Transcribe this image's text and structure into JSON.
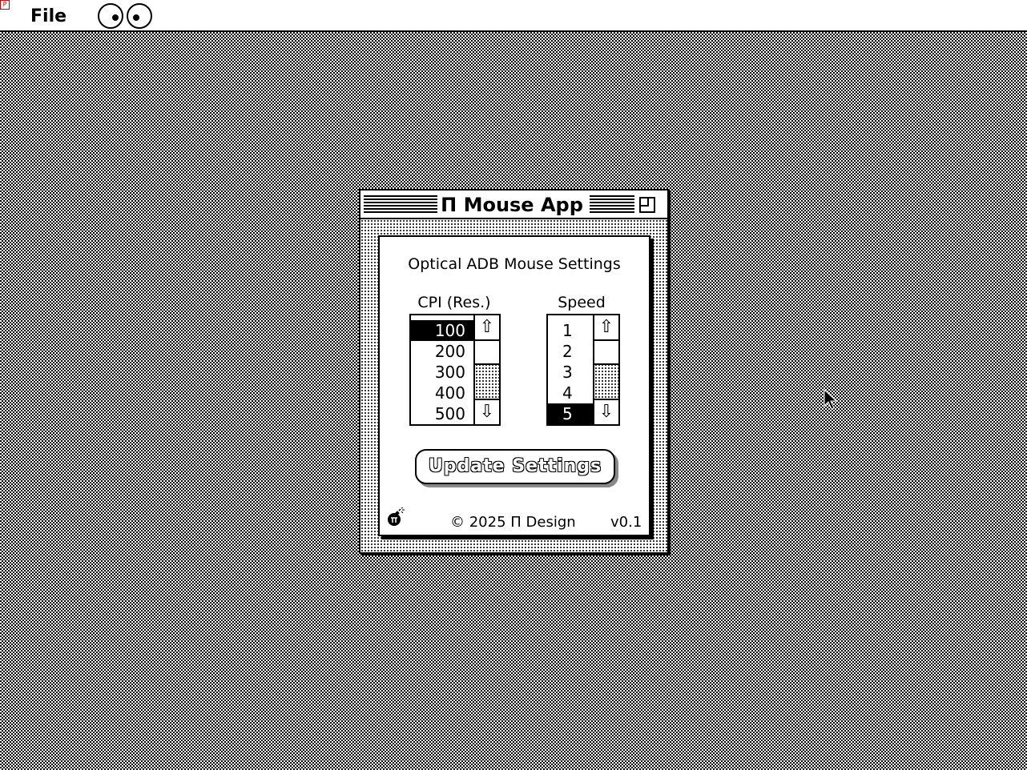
{
  "menubar": {
    "apple_glyph": "P",
    "file_label": "File",
    "eyes_icon": "xeyes-icon"
  },
  "window": {
    "title": "Π Mouse App"
  },
  "panel": {
    "heading": "Optical ADB Mouse Settings",
    "cpi": {
      "label": "CPI (Res.)",
      "items": [
        "100",
        "200",
        "300",
        "400",
        "500"
      ],
      "selected": "100"
    },
    "speed": {
      "label": "Speed",
      "items": [
        "1",
        "2",
        "3",
        "4",
        "5"
      ],
      "selected": "5"
    },
    "update_button": "Update Settings",
    "update_button_state": "disabled",
    "copyright": "© 2025 Π Design",
    "version": "v0.1",
    "bomb_icon": "bomb-icon"
  },
  "icons": {
    "scroll_up": "⇧",
    "scroll_down": "⇩"
  }
}
